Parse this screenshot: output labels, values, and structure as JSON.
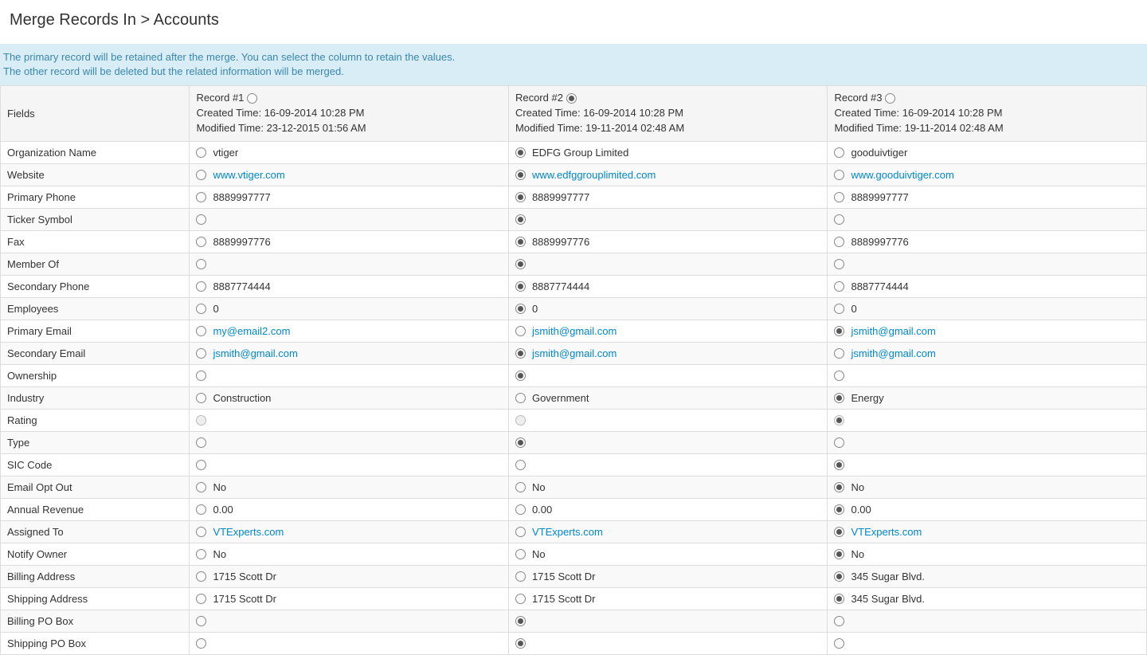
{
  "page_title": "Merge Records In > Accounts",
  "banner_line1": "The primary record will be retained after the merge. You can select the column to retain the values.",
  "banner_line2": "The other record will be deleted but the related information will be merged.",
  "fields_header": "Fields",
  "records": [
    {
      "label": "Record #1",
      "created": "Created Time: 16-09-2014 10:28 PM",
      "modified": "Modified Time: 23-12-2015 01:56 AM",
      "primary_selected": false
    },
    {
      "label": "Record #2",
      "created": "Created Time: 16-09-2014 10:28 PM",
      "modified": "Modified Time: 19-11-2014 02:48 AM",
      "primary_selected": true
    },
    {
      "label": "Record #3",
      "created": "Created Time: 16-09-2014 10:28 PM",
      "modified": "Modified Time: 19-11-2014 02:48 AM",
      "primary_selected": false
    }
  ],
  "rows": [
    {
      "field": "Organization Name",
      "cells": [
        {
          "value": "vtiger",
          "link": false,
          "selected": false,
          "disabled": false
        },
        {
          "value": "EDFG Group Limited",
          "link": false,
          "selected": true,
          "disabled": false
        },
        {
          "value": "gooduivtiger",
          "link": false,
          "selected": false,
          "disabled": false
        }
      ]
    },
    {
      "field": "Website",
      "cells": [
        {
          "value": "www.vtiger.com",
          "link": true,
          "selected": false,
          "disabled": false
        },
        {
          "value": "www.edfggrouplimited.com",
          "link": true,
          "selected": true,
          "disabled": false
        },
        {
          "value": "www.gooduivtiger.com",
          "link": true,
          "selected": false,
          "disabled": false
        }
      ]
    },
    {
      "field": "Primary Phone",
      "cells": [
        {
          "value": "8889997777",
          "link": false,
          "selected": false,
          "disabled": false
        },
        {
          "value": "8889997777",
          "link": false,
          "selected": true,
          "disabled": false
        },
        {
          "value": "8889997777",
          "link": false,
          "selected": false,
          "disabled": false
        }
      ]
    },
    {
      "field": "Ticker Symbol",
      "cells": [
        {
          "value": "",
          "link": false,
          "selected": false,
          "disabled": false
        },
        {
          "value": "",
          "link": false,
          "selected": true,
          "disabled": false
        },
        {
          "value": "",
          "link": false,
          "selected": false,
          "disabled": false
        }
      ]
    },
    {
      "field": "Fax",
      "cells": [
        {
          "value": "8889997776",
          "link": false,
          "selected": false,
          "disabled": false
        },
        {
          "value": "8889997776",
          "link": false,
          "selected": true,
          "disabled": false
        },
        {
          "value": "8889997776",
          "link": false,
          "selected": false,
          "disabled": false
        }
      ]
    },
    {
      "field": "Member Of",
      "cells": [
        {
          "value": "",
          "link": false,
          "selected": false,
          "disabled": false
        },
        {
          "value": "",
          "link": false,
          "selected": true,
          "disabled": false
        },
        {
          "value": "",
          "link": false,
          "selected": false,
          "disabled": false
        }
      ]
    },
    {
      "field": "Secondary Phone",
      "cells": [
        {
          "value": "8887774444",
          "link": false,
          "selected": false,
          "disabled": false
        },
        {
          "value": "8887774444",
          "link": false,
          "selected": true,
          "disabled": false
        },
        {
          "value": "8887774444",
          "link": false,
          "selected": false,
          "disabled": false
        }
      ]
    },
    {
      "field": "Employees",
      "cells": [
        {
          "value": "0",
          "link": false,
          "selected": false,
          "disabled": false
        },
        {
          "value": "0",
          "link": false,
          "selected": true,
          "disabled": false
        },
        {
          "value": "0",
          "link": false,
          "selected": false,
          "disabled": false
        }
      ]
    },
    {
      "field": "Primary Email",
      "cells": [
        {
          "value": "my@email2.com",
          "link": true,
          "selected": false,
          "disabled": false
        },
        {
          "value": "jsmith@gmail.com",
          "link": true,
          "selected": false,
          "disabled": false
        },
        {
          "value": "jsmith@gmail.com",
          "link": true,
          "selected": true,
          "disabled": false
        }
      ]
    },
    {
      "field": "Secondary Email",
      "cells": [
        {
          "value": "jsmith@gmail.com",
          "link": true,
          "selected": false,
          "disabled": false
        },
        {
          "value": "jsmith@gmail.com",
          "link": true,
          "selected": true,
          "disabled": false
        },
        {
          "value": "jsmith@gmail.com",
          "link": true,
          "selected": false,
          "disabled": false
        }
      ]
    },
    {
      "field": "Ownership",
      "cells": [
        {
          "value": "",
          "link": false,
          "selected": false,
          "disabled": false
        },
        {
          "value": "",
          "link": false,
          "selected": true,
          "disabled": false
        },
        {
          "value": "",
          "link": false,
          "selected": false,
          "disabled": false
        }
      ]
    },
    {
      "field": "Industry",
      "cells": [
        {
          "value": "Construction",
          "link": false,
          "selected": false,
          "disabled": false
        },
        {
          "value": "Government",
          "link": false,
          "selected": false,
          "disabled": false
        },
        {
          "value": "Energy",
          "link": false,
          "selected": true,
          "disabled": false
        }
      ]
    },
    {
      "field": "Rating",
      "cells": [
        {
          "value": "",
          "link": false,
          "selected": false,
          "disabled": true
        },
        {
          "value": "",
          "link": false,
          "selected": false,
          "disabled": true
        },
        {
          "value": "",
          "link": false,
          "selected": true,
          "disabled": true
        }
      ]
    },
    {
      "field": "Type",
      "cells": [
        {
          "value": "",
          "link": false,
          "selected": false,
          "disabled": false
        },
        {
          "value": "",
          "link": false,
          "selected": true,
          "disabled": false
        },
        {
          "value": "",
          "link": false,
          "selected": false,
          "disabled": false
        }
      ]
    },
    {
      "field": "SIC Code",
      "cells": [
        {
          "value": "",
          "link": false,
          "selected": false,
          "disabled": false
        },
        {
          "value": "",
          "link": false,
          "selected": false,
          "disabled": false
        },
        {
          "value": "",
          "link": false,
          "selected": true,
          "disabled": false
        }
      ]
    },
    {
      "field": "Email Opt Out",
      "cells": [
        {
          "value": "No",
          "link": false,
          "selected": false,
          "disabled": false
        },
        {
          "value": "No",
          "link": false,
          "selected": false,
          "disabled": false
        },
        {
          "value": "No",
          "link": false,
          "selected": true,
          "disabled": false
        }
      ]
    },
    {
      "field": "Annual Revenue",
      "cells": [
        {
          "value": "0.00",
          "link": false,
          "selected": false,
          "disabled": false
        },
        {
          "value": "0.00",
          "link": false,
          "selected": false,
          "disabled": false
        },
        {
          "value": "0.00",
          "link": false,
          "selected": true,
          "disabled": false
        }
      ]
    },
    {
      "field": "Assigned To",
      "cells": [
        {
          "value": " VTExperts.com",
          "link": true,
          "selected": false,
          "disabled": false
        },
        {
          "value": " VTExperts.com",
          "link": true,
          "selected": false,
          "disabled": false
        },
        {
          "value": " VTExperts.com",
          "link": true,
          "selected": true,
          "disabled": false
        }
      ]
    },
    {
      "field": "Notify Owner",
      "cells": [
        {
          "value": "No",
          "link": false,
          "selected": false,
          "disabled": false
        },
        {
          "value": "No",
          "link": false,
          "selected": false,
          "disabled": false
        },
        {
          "value": "No",
          "link": false,
          "selected": true,
          "disabled": false
        }
      ]
    },
    {
      "field": "Billing Address",
      "cells": [
        {
          "value": "1715 Scott Dr",
          "link": false,
          "selected": false,
          "disabled": false
        },
        {
          "value": "1715 Scott Dr",
          "link": false,
          "selected": false,
          "disabled": false
        },
        {
          "value": "345 Sugar Blvd.",
          "link": false,
          "selected": true,
          "disabled": false
        }
      ]
    },
    {
      "field": "Shipping Address",
      "cells": [
        {
          "value": "1715 Scott Dr",
          "link": false,
          "selected": false,
          "disabled": false
        },
        {
          "value": "1715 Scott Dr",
          "link": false,
          "selected": false,
          "disabled": false
        },
        {
          "value": "345 Sugar Blvd.",
          "link": false,
          "selected": true,
          "disabled": false
        }
      ]
    },
    {
      "field": "Billing PO Box",
      "cells": [
        {
          "value": "",
          "link": false,
          "selected": false,
          "disabled": false
        },
        {
          "value": "",
          "link": false,
          "selected": true,
          "disabled": false
        },
        {
          "value": "",
          "link": false,
          "selected": false,
          "disabled": false
        }
      ]
    },
    {
      "field": "Shipping PO Box",
      "cells": [
        {
          "value": "",
          "link": false,
          "selected": false,
          "disabled": false
        },
        {
          "value": "",
          "link": false,
          "selected": true,
          "disabled": false
        },
        {
          "value": "",
          "link": false,
          "selected": false,
          "disabled": false
        }
      ]
    }
  ]
}
